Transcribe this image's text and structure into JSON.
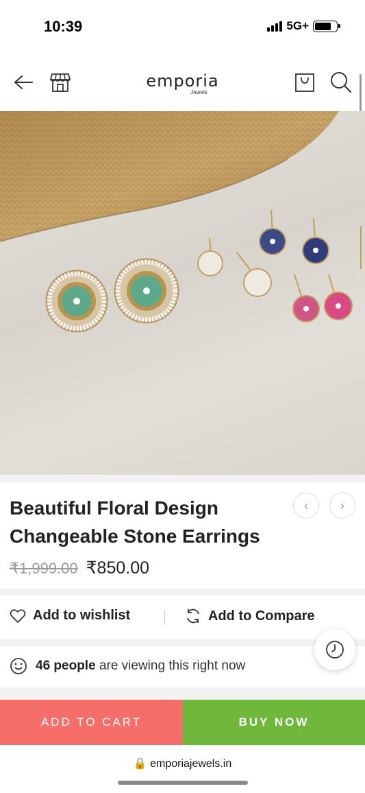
{
  "status_bar": {
    "time": "10:39",
    "network": "5G+",
    "battery_level": 0.75
  },
  "header": {
    "logo_main": "emporia",
    "logo_sub": "Jewels",
    "icons": [
      "back-arrow-icon",
      "store-icon",
      "shopping-bag-icon",
      "search-icon"
    ]
  },
  "product": {
    "image_alt": "Earrings product photo",
    "title_line1": "Beautiful Floral Design",
    "title_line2": "Changeable Stone Earrings",
    "old_price": "₹1,999.00",
    "new_price": "₹850.00"
  },
  "actions": {
    "wishlist_label": "Add to wishlist",
    "compare_label": "Add to Compare"
  },
  "viewers": {
    "count_text": "46 people",
    "suffix_text": "are viewing this right now"
  },
  "cart": {
    "add_to_cart_label": "ADD TO CART",
    "buy_now_label": "BUY NOW",
    "add_to_cart_color": "#f56e6a",
    "buy_now_color": "#6fb83b"
  },
  "browser": {
    "url": "emporiajewels.in"
  }
}
